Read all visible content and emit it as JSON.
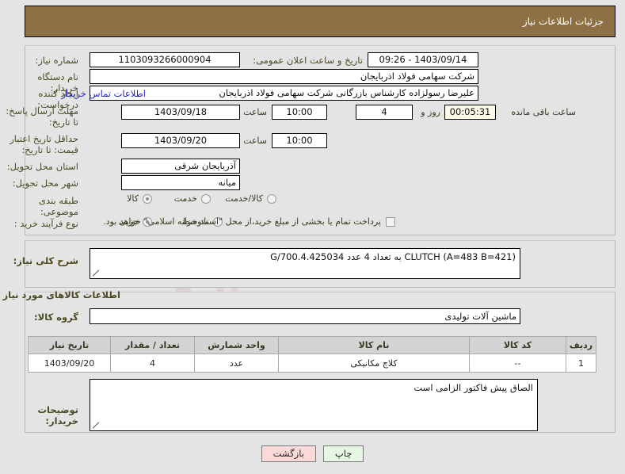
{
  "header": {
    "title": "جزئیات اطلاعات نیاز"
  },
  "watermark": {
    "text": "ArtaTender.net"
  },
  "form": {
    "need_number": {
      "label": "شماره نیاز:",
      "value": "1103093266000904"
    },
    "announce_datetime": {
      "label": "تاریخ و ساعت اعلان عمومی:",
      "value": "1403/09/14 - 09:26"
    },
    "buyer_org": {
      "label": "نام دستگاه خریدار:",
      "value": "شرکت سهامی فولاد اذربایجان"
    },
    "request_creator": {
      "label": "ایجاد کننده درخواست:",
      "value": "علیرضا رسولزاده کارشناس بازرگانی شرکت سهامی فولاد اذربایجان"
    },
    "buyer_contact_link": "اطلاعات تماس خریدار",
    "response_deadline": {
      "label": "مهلت ارسال پاسخ: تا تاریخ:",
      "date": "1403/09/18",
      "time_label": "ساعت",
      "time": "10:00",
      "days": "4",
      "days_label": "روز و",
      "remaining": "00:05:31",
      "remaining_label": "ساعت باقی مانده"
    },
    "price_validity": {
      "label": "حداقل تاریخ اعتبار قیمت: تا تاریخ:",
      "date": "1403/09/20",
      "time_label": "ساعت",
      "time": "10:00"
    },
    "delivery_province": {
      "label": "استان محل تحویل:",
      "value": "آذربایجان شرقی"
    },
    "delivery_city": {
      "label": "شهر محل تحویل:",
      "value": "میانه"
    },
    "subject_category": {
      "label": "طبقه بندی موضوعی:",
      "options": [
        "کالا",
        "خدمت",
        "کالا/خدمت"
      ],
      "selected": "کالا"
    },
    "purchase_process": {
      "label": "نوع فرآیند خرید :",
      "options": [
        "جزیی",
        "متوسط"
      ],
      "selected": "جزیی"
    },
    "treasury_note": {
      "text": "پرداخت تمام یا بخشی از مبلغ خرید،از محل \"اسناد خزانه اسلامی\" خواهد بود.",
      "checked": false
    }
  },
  "summary": {
    "label": "شرح کلی نیاز:",
    "value": "(A=483 B=421)  CLUTCH   به تعداد 4 عدد G/700.4.425034"
  },
  "goods_section": {
    "heading": "اطلاعات کالاهای مورد نیاز",
    "group_label": "گروه کالا:",
    "group_value": "ماشین آلات تولیدی",
    "table": {
      "columns": [
        "ردیف",
        "کد کالا",
        "نام کالا",
        "واحد شمارش",
        "تعداد / مقدار",
        "تاریخ نیاز"
      ],
      "rows": [
        [
          "1",
          "--",
          "کلاچ مکانیکی",
          "عدد",
          "4",
          "1403/09/20"
        ]
      ]
    }
  },
  "buyer_notes": {
    "label": "توضیحات خریدار:",
    "value": "الصاق پیش فاکتور الزامی است"
  },
  "buttons": {
    "print": "چاپ",
    "back": "بازگشت"
  }
}
